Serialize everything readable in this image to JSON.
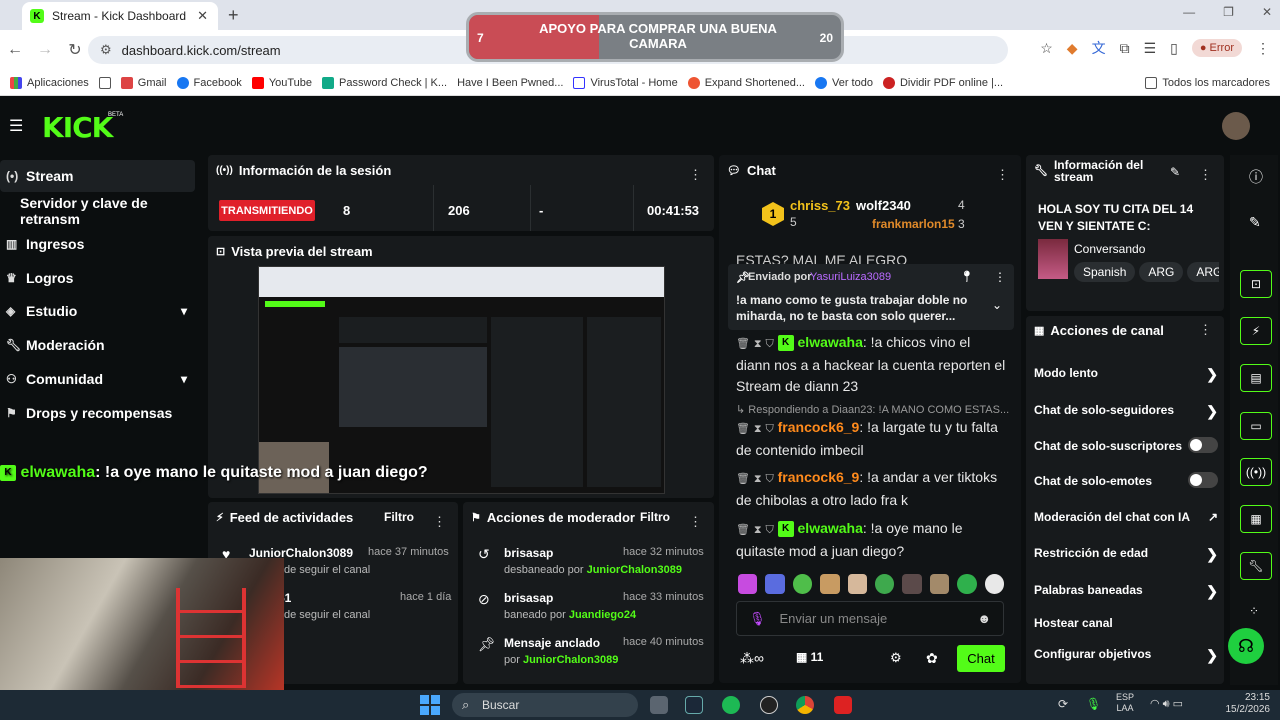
{
  "browser": {
    "tab_title": "Stream - Kick Dashboard",
    "url": "dashboard.kick.com/stream",
    "error_label": "Error",
    "bookmarks": [
      "Aplicaciones",
      "Gmail",
      "Facebook",
      "YouTube",
      "Password Check | K...",
      "Have I Been Pwned...",
      "VirusTotal - Home",
      "Expand Shortened...",
      "Ver todo",
      "Dividir PDF online |...",
      "Todos los marcadores"
    ]
  },
  "goal": {
    "title": "APOYO PARA COMPRAR UNA BUENA CAMARA",
    "current": "7",
    "target": "20",
    "progress": 0.35
  },
  "sidebar": {
    "items": [
      {
        "label": "Stream",
        "icon": "radio-icon"
      },
      {
        "label": "Servidor y clave de retransm",
        "icon": ""
      },
      {
        "label": "Ingresos",
        "icon": "bar-chart-icon"
      },
      {
        "label": "Logros",
        "icon": "trophy-icon"
      },
      {
        "label": "Estudio",
        "icon": "layers-icon"
      },
      {
        "label": "Moderación",
        "icon": "wrench-icon"
      },
      {
        "label": "Comunidad",
        "icon": "users-icon"
      },
      {
        "label": "Drops y recompensas",
        "icon": "gift-icon"
      }
    ]
  },
  "session": {
    "title": "Información de la sesión",
    "status": "TRANSMITIENDO",
    "viewers": "8",
    "followers": "206",
    "subs": "-",
    "duration": "00:41:53"
  },
  "preview": {
    "title": "Vista previa del stream"
  },
  "overlay_chat": {
    "user": "elwawaha",
    "text": ": !a oye mano le quitaste mod a juan diego?"
  },
  "activity": {
    "title": "Feed de actividades",
    "filter": "Filtro",
    "items": [
      {
        "name": "JuniorChalon3089",
        "time": "hace 37 minutos",
        "desc": "de seguir el canal"
      },
      {
        "name": "51",
        "time": "hace 1 día",
        "desc": "de seguir el canal"
      }
    ]
  },
  "modactions": {
    "title": "Acciones de moderador",
    "filter": "Filtro",
    "items": [
      {
        "name": "brisasap",
        "time": "hace 32 minutos",
        "action": "desbaneado por",
        "by": "JuniorChalon3089"
      },
      {
        "name": "brisasap",
        "time": "hace 33 minutos",
        "action": "baneado por",
        "by": "Juandiego24"
      },
      {
        "name": "Mensaje anclado",
        "time": "hace 40 minutos",
        "action": "por",
        "by": "JuniorChalon3089"
      }
    ]
  },
  "chat": {
    "title": "Chat",
    "top": [
      {
        "name": "chriss_73",
        "count": "5"
      },
      {
        "name": "wolf2340",
        "count": "4"
      },
      {
        "name": "frankmarlon15",
        "count": "3"
      }
    ],
    "partial_text": "ESTAS? MAL ME ALEGRO",
    "pinned_by_label": "Enviado por",
    "pinned_user": "YasuriLuiza3089",
    "pinned_text": "!a mano como te gusta trabajar doble no miharda, no te basta con solo querer...",
    "messages": [
      {
        "user": "elwawaha",
        "text": ": !a chicos vino el diann nos a a hackear la cuenta reporten el Stream de diann 23"
      },
      {
        "reply": "Respondiendo a Diaan23: !A MANO COMO ESTAS...",
        "user": "francock6_9",
        "text": ": !a largate tu y tu falta de contenido imbecil"
      },
      {
        "user": "francock6_9",
        "text": ": !a andar a ver tiktoks de chibolas a otro lado fra k"
      },
      {
        "user": "elwawaha",
        "text": ": !a oye mano le quitaste mod a juan diego?"
      }
    ],
    "input_placeholder": "Enviar un mensaje",
    "viewer_count": "11",
    "send_label": "Chat"
  },
  "streaminfo": {
    "title": "Información del stream",
    "stream_title": "HOLA SOY TU CITA DEL 14 VEN Y SIENTATE C:",
    "category": "Conversando",
    "tags": [
      "Spanish",
      "ARG",
      "ARG"
    ]
  },
  "channel": {
    "title": "Acciones de canal",
    "items": [
      "Modo lento",
      "Chat de solo-seguidores",
      "Chat de solo-suscriptores",
      "Chat de solo-emotes",
      "Moderación del chat con IA",
      "Restricción de edad",
      "Palabras baneadas",
      "Hostear canal",
      "Configurar objetivos"
    ]
  },
  "taskbar": {
    "search": "Buscar",
    "lang": "ESP",
    "lang2": "LAA",
    "time": "23:15",
    "date": "15/2/2026"
  },
  "colors": {
    "accent": "#53fc18",
    "live": "#e0202a",
    "panel": "#171a1c"
  }
}
